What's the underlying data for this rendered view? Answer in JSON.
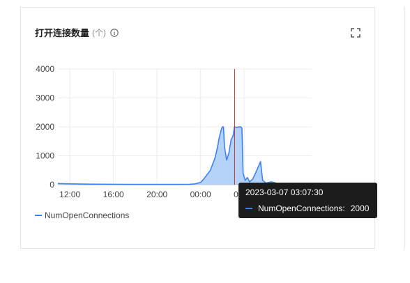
{
  "card": {
    "title": "打开连接数量",
    "unit": "(个)"
  },
  "icons": {
    "info": "info-icon",
    "expand": "fullscreen-expand-icon"
  },
  "colors": {
    "series": "#3b82f6",
    "area": "#a8cbf7",
    "cursor_line": "#c0392b",
    "tooltip_bg": "#1c1c1c"
  },
  "legend": {
    "label": "NumOpenConnections"
  },
  "tooltip": {
    "time": "2023-03-07 03:07:30",
    "series_name": "NumOpenConnections:",
    "value": "2000"
  },
  "chart_data": {
    "type": "area",
    "title": "打开连接数量",
    "xlabel": "",
    "ylabel": "",
    "ylim": [
      0,
      4000
    ],
    "yticks": [
      "4000",
      "3000",
      "2000",
      "1000",
      "0"
    ],
    "ytick_values": [
      4000,
      3000,
      2000,
      1000,
      0
    ],
    "xticks": [
      "12:00",
      "16:00",
      "20:00",
      "00:00",
      "04:00"
    ],
    "xtick_hours": [
      12,
      16,
      20,
      24,
      28
    ],
    "xlim_hours": [
      10.9,
      34.2
    ],
    "cursor_hour": 27.125,
    "grid": true,
    "legend_position": "bottom-left",
    "series": [
      {
        "name": "NumOpenConnections",
        "points": [
          [
            10.9,
            40
          ],
          [
            12,
            30
          ],
          [
            14,
            20
          ],
          [
            16,
            15
          ],
          [
            18,
            10
          ],
          [
            20,
            10
          ],
          [
            22,
            10
          ],
          [
            23,
            15
          ],
          [
            23.5,
            30
          ],
          [
            24,
            80
          ],
          [
            24.3,
            200
          ],
          [
            24.6,
            350
          ],
          [
            24.9,
            500
          ],
          [
            25.1,
            700
          ],
          [
            25.3,
            900
          ],
          [
            25.5,
            1200
          ],
          [
            25.7,
            1600
          ],
          [
            25.9,
            1900
          ],
          [
            26.0,
            2000
          ],
          [
            26.1,
            2000
          ],
          [
            26.2,
            1300
          ],
          [
            26.4,
            850
          ],
          [
            26.6,
            1100
          ],
          [
            26.8,
            1550
          ],
          [
            27.0,
            1700
          ],
          [
            27.1,
            2000
          ],
          [
            27.3,
            1980
          ],
          [
            27.5,
            2000
          ],
          [
            27.7,
            2000
          ],
          [
            27.8,
            1950
          ],
          [
            27.9,
            400
          ],
          [
            28.1,
            150
          ],
          [
            28.3,
            250
          ],
          [
            28.5,
            100
          ],
          [
            28.8,
            200
          ],
          [
            29.1,
            450
          ],
          [
            29.5,
            800
          ],
          [
            29.7,
            150
          ],
          [
            30.0,
            60
          ],
          [
            30.5,
            100
          ],
          [
            31.0,
            50
          ],
          [
            32.0,
            40
          ],
          [
            33.0,
            30
          ],
          [
            34.2,
            25
          ]
        ]
      }
    ]
  }
}
